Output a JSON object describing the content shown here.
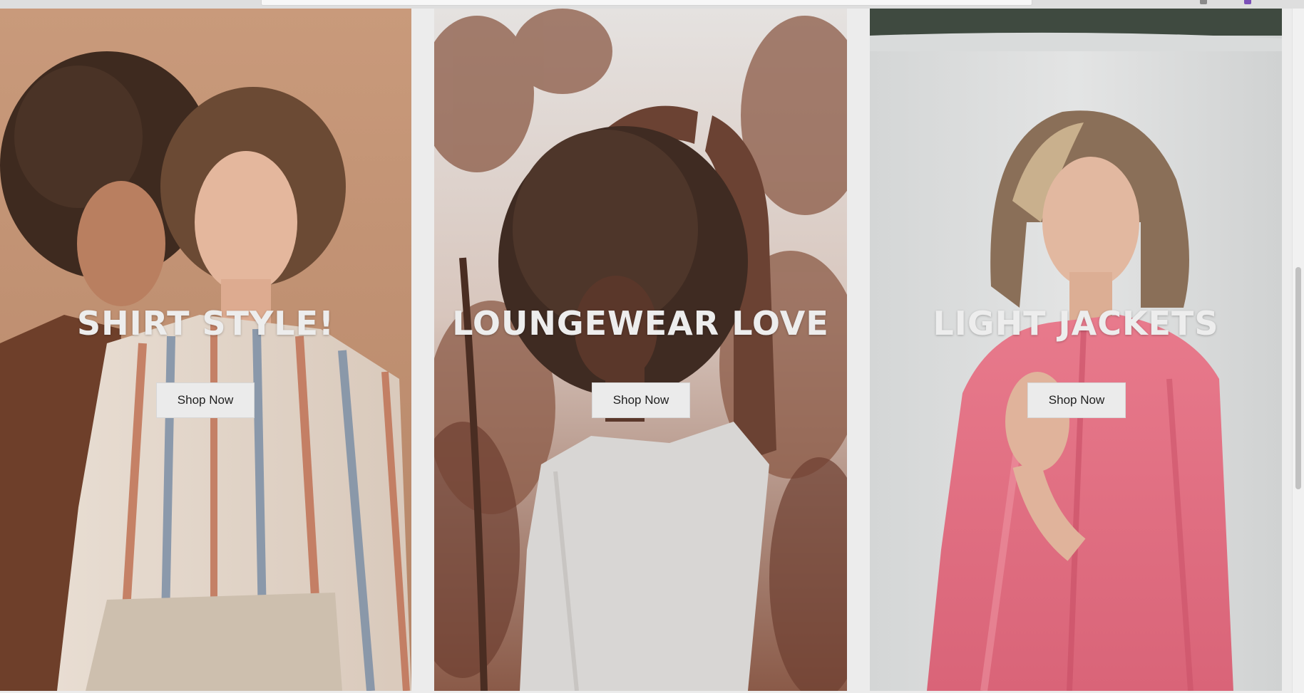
{
  "cards": [
    {
      "title": "SHIRT STYLE!",
      "button_label": "Shop Now",
      "image_alt": "Two women, one in a striped linen shirt, against a tan backdrop"
    },
    {
      "title": "LOUNGEWEAR LOVE",
      "button_label": "Shop Now",
      "image_alt": "Woman with voluminous curly hair in a white tee among autumn leaves"
    },
    {
      "title": "LIGHT JACKETS",
      "button_label": "Shop Now",
      "image_alt": "Woman with a blonde bob in a pink jacket against a white backdrop"
    }
  ],
  "icons": {
    "scrollbar": "vertical-scrollbar"
  },
  "colors": {
    "title_text": "#ededed",
    "button_bg": "#ebebeb",
    "button_text": "#1e1e1e",
    "page_bg": "#ececec"
  }
}
